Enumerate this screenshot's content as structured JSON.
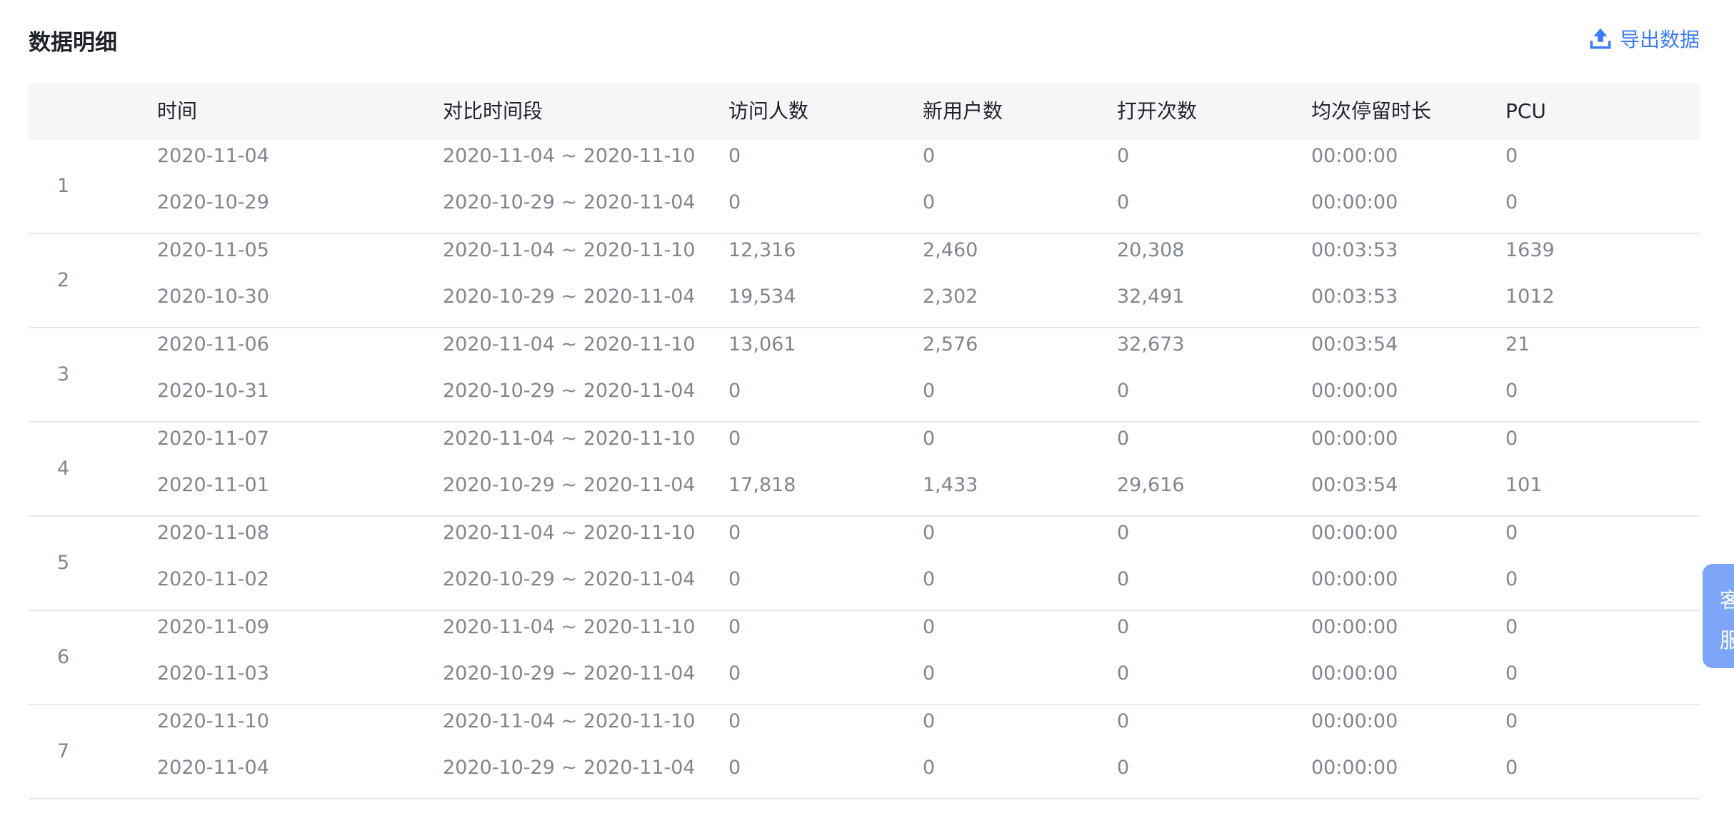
{
  "page": {
    "title": "数据明细",
    "export_label": "导出数据",
    "accent": "#3b7cf6"
  },
  "table": {
    "columns": [
      "",
      "时间",
      "对比时间段",
      "访问人数",
      "新用户数",
      "打开次数",
      "均次停留时长",
      "PCU"
    ],
    "groups": [
      {
        "index": "1",
        "rows": [
          {
            "time": "2020-11-04",
            "range": "2020-11-04 ~ 2020-11-10",
            "visitors": "0",
            "new_users": "0",
            "opens": "0",
            "avg_stay": "00:00:00",
            "pcu": "0"
          },
          {
            "time": "2020-10-29",
            "range": "2020-10-29 ~ 2020-11-04",
            "visitors": "0",
            "new_users": "0",
            "opens": "0",
            "avg_stay": "00:00:00",
            "pcu": "0"
          }
        ]
      },
      {
        "index": "2",
        "rows": [
          {
            "time": "2020-11-05",
            "range": "2020-11-04 ~ 2020-11-10",
            "visitors": "12,316",
            "new_users": "2,460",
            "opens": "20,308",
            "avg_stay": "00:03:53",
            "pcu": "1639"
          },
          {
            "time": "2020-10-30",
            "range": "2020-10-29 ~ 2020-11-04",
            "visitors": "19,534",
            "new_users": "2,302",
            "opens": "32,491",
            "avg_stay": "00:03:53",
            "pcu": "1012"
          }
        ]
      },
      {
        "index": "3",
        "rows": [
          {
            "time": "2020-11-06",
            "range": "2020-11-04 ~ 2020-11-10",
            "visitors": "13,061",
            "new_users": "2,576",
            "opens": "32,673",
            "avg_stay": "00:03:54",
            "pcu": "21"
          },
          {
            "time": "2020-10-31",
            "range": "2020-10-29 ~ 2020-11-04",
            "visitors": "0",
            "new_users": "0",
            "opens": "0",
            "avg_stay": "00:00:00",
            "pcu": "0"
          }
        ]
      },
      {
        "index": "4",
        "rows": [
          {
            "time": "2020-11-07",
            "range": "2020-11-04 ~ 2020-11-10",
            "visitors": "0",
            "new_users": "0",
            "opens": "0",
            "avg_stay": "00:00:00",
            "pcu": "0"
          },
          {
            "time": "2020-11-01",
            "range": "2020-10-29 ~ 2020-11-04",
            "visitors": "17,818",
            "new_users": "1,433",
            "opens": "29,616",
            "avg_stay": "00:03:54",
            "pcu": "101"
          }
        ]
      },
      {
        "index": "5",
        "rows": [
          {
            "time": "2020-11-08",
            "range": "2020-11-04 ~ 2020-11-10",
            "visitors": "0",
            "new_users": "0",
            "opens": "0",
            "avg_stay": "00:00:00",
            "pcu": "0"
          },
          {
            "time": "2020-11-02",
            "range": "2020-10-29 ~ 2020-11-04",
            "visitors": "0",
            "new_users": "0",
            "opens": "0",
            "avg_stay": "00:00:00",
            "pcu": "0"
          }
        ]
      },
      {
        "index": "6",
        "rows": [
          {
            "time": "2020-11-09",
            "range": "2020-11-04 ~ 2020-11-10",
            "visitors": "0",
            "new_users": "0",
            "opens": "0",
            "avg_stay": "00:00:00",
            "pcu": "0"
          },
          {
            "time": "2020-11-03",
            "range": "2020-10-29 ~ 2020-11-04",
            "visitors": "0",
            "new_users": "0",
            "opens": "0",
            "avg_stay": "00:00:00",
            "pcu": "0"
          }
        ]
      },
      {
        "index": "7",
        "rows": [
          {
            "time": "2020-11-10",
            "range": "2020-11-04 ~ 2020-11-10",
            "visitors": "0",
            "new_users": "0",
            "opens": "0",
            "avg_stay": "00:00:00",
            "pcu": "0"
          },
          {
            "time": "2020-11-04",
            "range": "2020-10-29 ~ 2020-11-04",
            "visitors": "0",
            "new_users": "0",
            "opens": "0",
            "avg_stay": "00:00:00",
            "pcu": "0"
          }
        ]
      }
    ]
  },
  "service_tab": {
    "line1": "客",
    "line2": "服"
  }
}
